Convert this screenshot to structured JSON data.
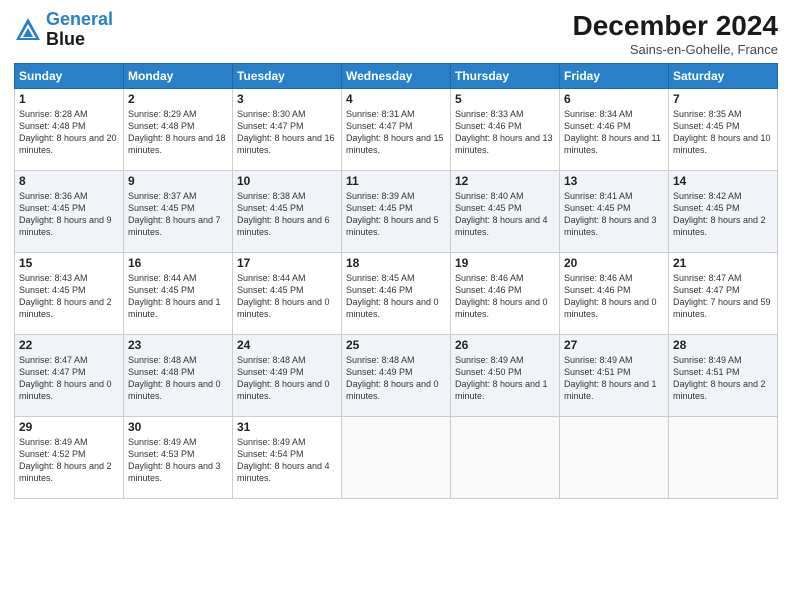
{
  "header": {
    "logo_line1": "General",
    "logo_line2": "Blue",
    "month_title": "December 2024",
    "subtitle": "Sains-en-Gohelle, France"
  },
  "weekdays": [
    "Sunday",
    "Monday",
    "Tuesday",
    "Wednesday",
    "Thursday",
    "Friday",
    "Saturday"
  ],
  "weeks": [
    [
      {
        "day": "1",
        "sunrise": "Sunrise: 8:28 AM",
        "sunset": "Sunset: 4:48 PM",
        "daylight": "Daylight: 8 hours and 20 minutes."
      },
      {
        "day": "2",
        "sunrise": "Sunrise: 8:29 AM",
        "sunset": "Sunset: 4:48 PM",
        "daylight": "Daylight: 8 hours and 18 minutes."
      },
      {
        "day": "3",
        "sunrise": "Sunrise: 8:30 AM",
        "sunset": "Sunset: 4:47 PM",
        "daylight": "Daylight: 8 hours and 16 minutes."
      },
      {
        "day": "4",
        "sunrise": "Sunrise: 8:31 AM",
        "sunset": "Sunset: 4:47 PM",
        "daylight": "Daylight: 8 hours and 15 minutes."
      },
      {
        "day": "5",
        "sunrise": "Sunrise: 8:33 AM",
        "sunset": "Sunset: 4:46 PM",
        "daylight": "Daylight: 8 hours and 13 minutes."
      },
      {
        "day": "6",
        "sunrise": "Sunrise: 8:34 AM",
        "sunset": "Sunset: 4:46 PM",
        "daylight": "Daylight: 8 hours and 11 minutes."
      },
      {
        "day": "7",
        "sunrise": "Sunrise: 8:35 AM",
        "sunset": "Sunset: 4:45 PM",
        "daylight": "Daylight: 8 hours and 10 minutes."
      }
    ],
    [
      {
        "day": "8",
        "sunrise": "Sunrise: 8:36 AM",
        "sunset": "Sunset: 4:45 PM",
        "daylight": "Daylight: 8 hours and 9 minutes."
      },
      {
        "day": "9",
        "sunrise": "Sunrise: 8:37 AM",
        "sunset": "Sunset: 4:45 PM",
        "daylight": "Daylight: 8 hours and 7 minutes."
      },
      {
        "day": "10",
        "sunrise": "Sunrise: 8:38 AM",
        "sunset": "Sunset: 4:45 PM",
        "daylight": "Daylight: 8 hours and 6 minutes."
      },
      {
        "day": "11",
        "sunrise": "Sunrise: 8:39 AM",
        "sunset": "Sunset: 4:45 PM",
        "daylight": "Daylight: 8 hours and 5 minutes."
      },
      {
        "day": "12",
        "sunrise": "Sunrise: 8:40 AM",
        "sunset": "Sunset: 4:45 PM",
        "daylight": "Daylight: 8 hours and 4 minutes."
      },
      {
        "day": "13",
        "sunrise": "Sunrise: 8:41 AM",
        "sunset": "Sunset: 4:45 PM",
        "daylight": "Daylight: 8 hours and 3 minutes."
      },
      {
        "day": "14",
        "sunrise": "Sunrise: 8:42 AM",
        "sunset": "Sunset: 4:45 PM",
        "daylight": "Daylight: 8 hours and 2 minutes."
      }
    ],
    [
      {
        "day": "15",
        "sunrise": "Sunrise: 8:43 AM",
        "sunset": "Sunset: 4:45 PM",
        "daylight": "Daylight: 8 hours and 2 minutes."
      },
      {
        "day": "16",
        "sunrise": "Sunrise: 8:44 AM",
        "sunset": "Sunset: 4:45 PM",
        "daylight": "Daylight: 8 hours and 1 minute."
      },
      {
        "day": "17",
        "sunrise": "Sunrise: 8:44 AM",
        "sunset": "Sunset: 4:45 PM",
        "daylight": "Daylight: 8 hours and 0 minutes."
      },
      {
        "day": "18",
        "sunrise": "Sunrise: 8:45 AM",
        "sunset": "Sunset: 4:46 PM",
        "daylight": "Daylight: 8 hours and 0 minutes."
      },
      {
        "day": "19",
        "sunrise": "Sunrise: 8:46 AM",
        "sunset": "Sunset: 4:46 PM",
        "daylight": "Daylight: 8 hours and 0 minutes."
      },
      {
        "day": "20",
        "sunrise": "Sunrise: 8:46 AM",
        "sunset": "Sunset: 4:46 PM",
        "daylight": "Daylight: 8 hours and 0 minutes."
      },
      {
        "day": "21",
        "sunrise": "Sunrise: 8:47 AM",
        "sunset": "Sunset: 4:47 PM",
        "daylight": "Daylight: 7 hours and 59 minutes."
      }
    ],
    [
      {
        "day": "22",
        "sunrise": "Sunrise: 8:47 AM",
        "sunset": "Sunset: 4:47 PM",
        "daylight": "Daylight: 8 hours and 0 minutes."
      },
      {
        "day": "23",
        "sunrise": "Sunrise: 8:48 AM",
        "sunset": "Sunset: 4:48 PM",
        "daylight": "Daylight: 8 hours and 0 minutes."
      },
      {
        "day": "24",
        "sunrise": "Sunrise: 8:48 AM",
        "sunset": "Sunset: 4:49 PM",
        "daylight": "Daylight: 8 hours and 0 minutes."
      },
      {
        "day": "25",
        "sunrise": "Sunrise: 8:48 AM",
        "sunset": "Sunset: 4:49 PM",
        "daylight": "Daylight: 8 hours and 0 minutes."
      },
      {
        "day": "26",
        "sunrise": "Sunrise: 8:49 AM",
        "sunset": "Sunset: 4:50 PM",
        "daylight": "Daylight: 8 hours and 1 minute."
      },
      {
        "day": "27",
        "sunrise": "Sunrise: 8:49 AM",
        "sunset": "Sunset: 4:51 PM",
        "daylight": "Daylight: 8 hours and 1 minute."
      },
      {
        "day": "28",
        "sunrise": "Sunrise: 8:49 AM",
        "sunset": "Sunset: 4:51 PM",
        "daylight": "Daylight: 8 hours and 2 minutes."
      }
    ],
    [
      {
        "day": "29",
        "sunrise": "Sunrise: 8:49 AM",
        "sunset": "Sunset: 4:52 PM",
        "daylight": "Daylight: 8 hours and 2 minutes."
      },
      {
        "day": "30",
        "sunrise": "Sunrise: 8:49 AM",
        "sunset": "Sunset: 4:53 PM",
        "daylight": "Daylight: 8 hours and 3 minutes."
      },
      {
        "day": "31",
        "sunrise": "Sunrise: 8:49 AM",
        "sunset": "Sunset: 4:54 PM",
        "daylight": "Daylight: 8 hours and 4 minutes."
      },
      null,
      null,
      null,
      null
    ]
  ]
}
